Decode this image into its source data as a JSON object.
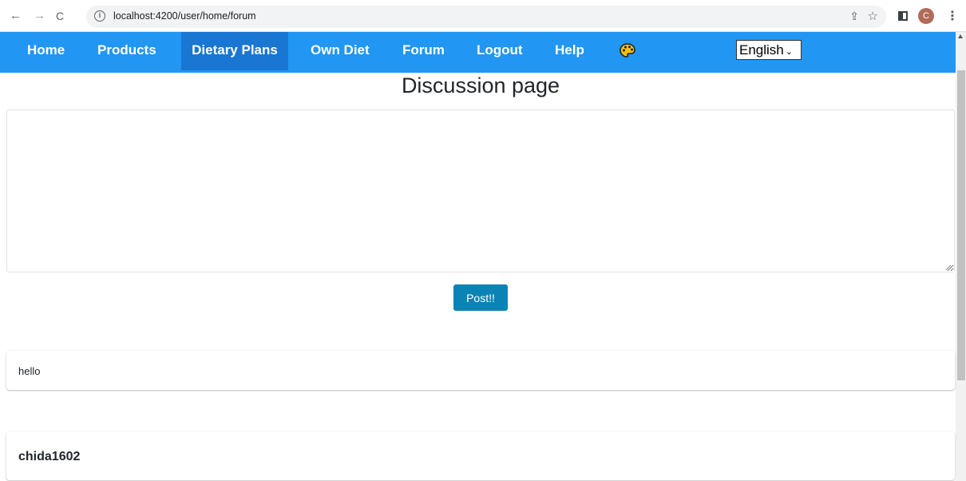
{
  "browser": {
    "back_icon": "←",
    "forward_icon": "→",
    "reload_icon": "C",
    "info_icon": "i",
    "url": "localhost:4200/user/home/forum",
    "share_icon": "⇪",
    "star_icon": "☆",
    "avatar_letter": "C",
    "menu_icon": "⋮"
  },
  "navbar": {
    "items": [
      {
        "label": "Home"
      },
      {
        "label": "Products"
      },
      {
        "label": "Dietary Plans"
      },
      {
        "label": "Own Diet"
      },
      {
        "label": "Forum"
      },
      {
        "label": "Logout"
      },
      {
        "label": "Help"
      }
    ],
    "active_item": "Dietary Plans",
    "theme_icon": "palette-icon",
    "language": {
      "selected": "English",
      "chevron": "⌄"
    },
    "color": "#2196f3",
    "active_color": "#1976d2"
  },
  "main": {
    "title": "Discussion page",
    "post_input": {
      "value": "",
      "placeholder": ""
    },
    "post_button": "Post!!",
    "post_button_color": "#0b84b5",
    "posts": [
      {
        "text": "hello"
      },
      {
        "text": "chida1602"
      }
    ]
  }
}
